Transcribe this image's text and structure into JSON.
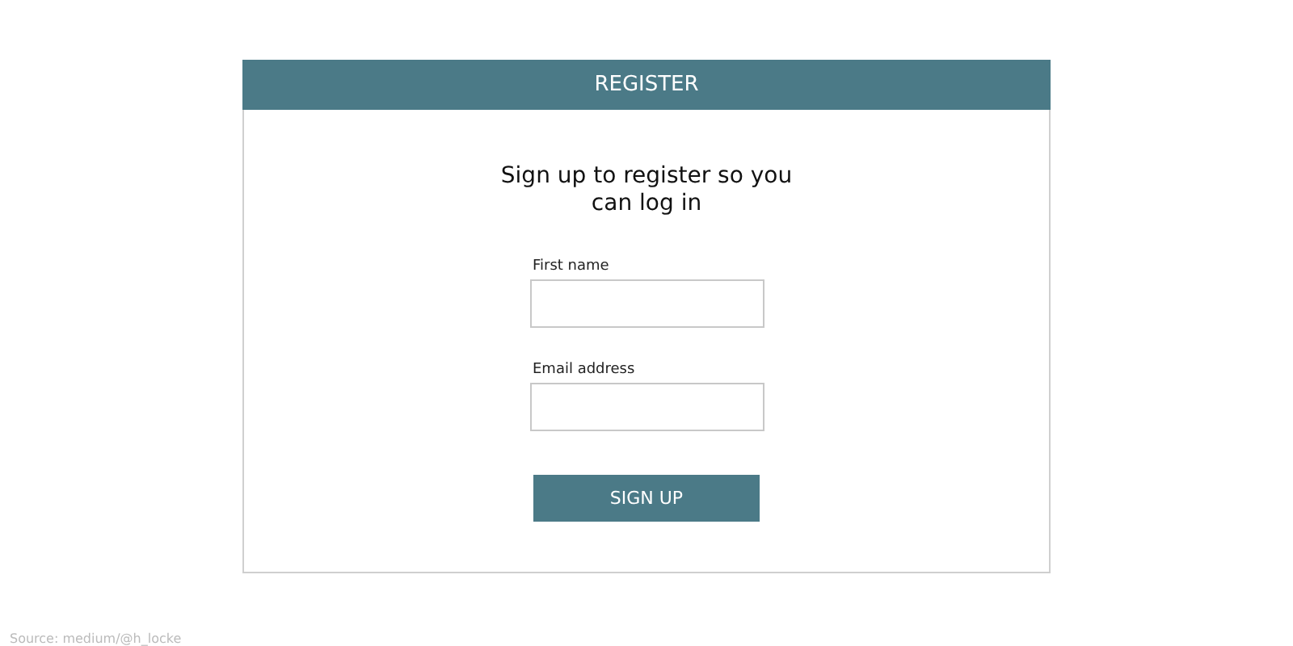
{
  "form": {
    "title": "REGISTER",
    "heading": "Sign up to register so you can log in",
    "fields": [
      {
        "label": "First name"
      },
      {
        "label": "Email address"
      }
    ],
    "button": "SIGN UP"
  },
  "caption": "Source: medium/@h_locke"
}
